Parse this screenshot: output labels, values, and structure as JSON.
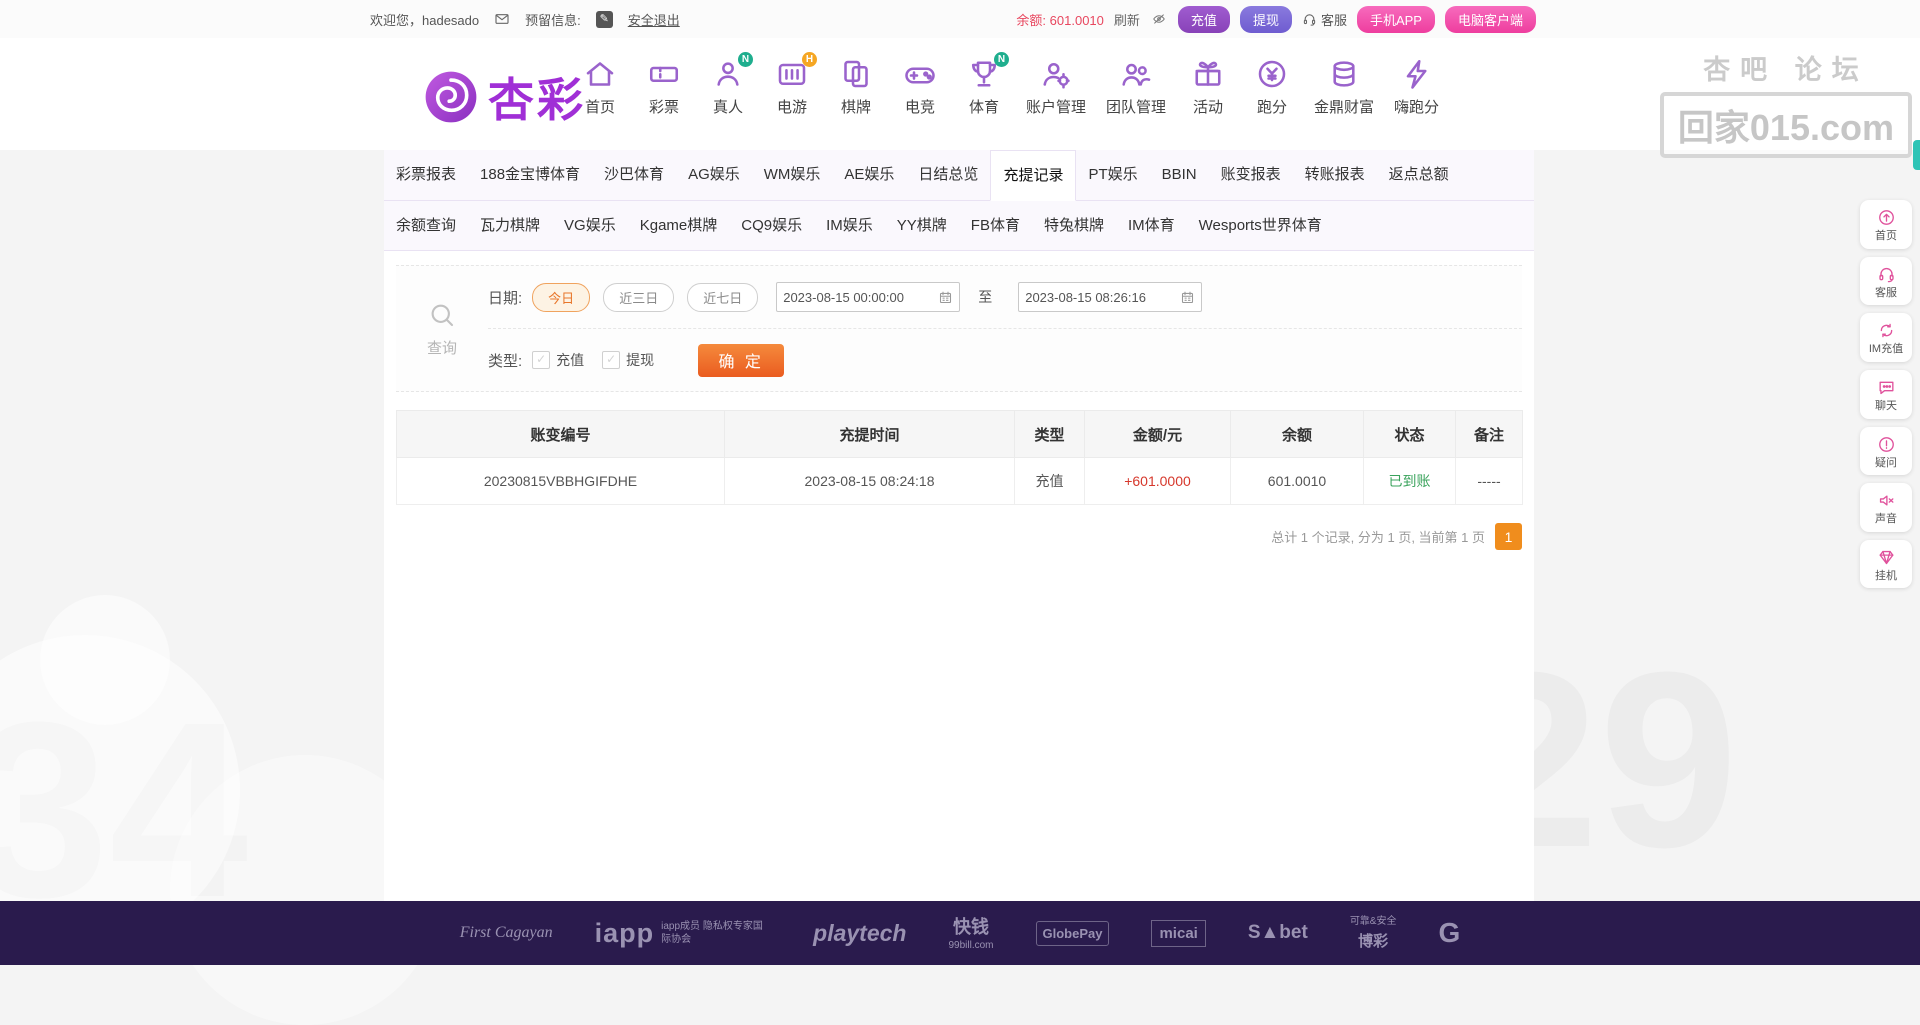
{
  "topbar": {
    "welcome": "欢迎您，hadesado",
    "reserved_label": "预留信息:",
    "logout": "安全退出",
    "balance_label": "余额:",
    "balance_value": "601.0010",
    "refresh": "刷新",
    "deposit": "充值",
    "withdraw": "提现",
    "service": "客服",
    "mobile_app": "手机APP",
    "pc_client": "电脑客户端"
  },
  "header": {
    "brand": "杏彩",
    "nav": [
      {
        "label": "首页",
        "icon": "home-icon",
        "badge": ""
      },
      {
        "label": "彩票",
        "icon": "ticket-icon",
        "badge": ""
      },
      {
        "label": "真人",
        "icon": "person-icon",
        "badge": "N"
      },
      {
        "label": "电游",
        "icon": "slot-icon",
        "badge": "H"
      },
      {
        "label": "棋牌",
        "icon": "tiles-icon",
        "badge": ""
      },
      {
        "label": "电竞",
        "icon": "gamepad-icon",
        "badge": ""
      },
      {
        "label": "体育",
        "icon": "trophy-icon",
        "badge": "N"
      },
      {
        "label": "账户管理",
        "icon": "account-icon",
        "badge": ""
      },
      {
        "label": "团队管理",
        "icon": "team-icon",
        "badge": ""
      },
      {
        "label": "活动",
        "icon": "gift-icon",
        "badge": ""
      },
      {
        "label": "跑分",
        "icon": "coin-icon",
        "badge": ""
      },
      {
        "label": "金鼎财富",
        "icon": "wealth-icon",
        "badge": ""
      },
      {
        "label": "嗨跑分",
        "icon": "run-icon",
        "badge": ""
      }
    ],
    "watermark_line1": "杏吧  论坛",
    "watermark_line2": "回家015.com"
  },
  "tabs": {
    "row1": [
      "彩票报表",
      "188金宝博体育",
      "沙巴体育",
      "AG娱乐",
      "WM娱乐",
      "AE娱乐",
      "日结总览",
      "充提记录",
      "PT娱乐",
      "BBIN",
      "账变报表",
      "转账报表",
      "返点总额"
    ],
    "active": "充提记录",
    "row2": [
      "余额查询",
      "瓦力棋牌",
      "VG娱乐",
      "Kgame棋牌",
      "CQ9娱乐",
      "IM娱乐",
      "YY棋牌",
      "FB体育",
      "特兔棋牌",
      "IM体育",
      "Wesports世界体育"
    ]
  },
  "query": {
    "panel_label": "查询",
    "date_label": "日期:",
    "quick": [
      "今日",
      "近三日",
      "近七日"
    ],
    "quick_active": "今日",
    "date_from": "2023-08-15 00:00:00",
    "to_label": "至",
    "date_to": "2023-08-15 08:26:16",
    "type_label": "类型:",
    "type_options": [
      "充值",
      "提现"
    ],
    "submit": "确 定"
  },
  "table": {
    "headers": [
      "账变编号",
      "充提时间",
      "类型",
      "金额/元",
      "余额",
      "状态",
      "备注"
    ],
    "rows": [
      {
        "id": "20230815VBBHGIFDHE",
        "time": "2023-08-15 08:24:18",
        "type": "充值",
        "amount": "+601.0000",
        "balance": "601.0010",
        "status": "已到账",
        "remark": "-----"
      }
    ],
    "pagination_text": "总计 1 个记录, 分为 1 页, 当前第 1 页",
    "page": "1"
  },
  "sidebar": {
    "items": [
      {
        "label": "首页",
        "icon": "top-icon"
      },
      {
        "label": "客服",
        "icon": "headset-icon"
      },
      {
        "label": "IM充值",
        "icon": "recharge-icon"
      },
      {
        "label": "聊天",
        "icon": "chat-icon"
      },
      {
        "label": "疑问",
        "icon": "question-icon"
      },
      {
        "label": "声音",
        "icon": "sound-icon"
      },
      {
        "label": "挂机",
        "icon": "gem-icon"
      }
    ]
  },
  "footer": {
    "logos": [
      {
        "text": "First Cagayan",
        "sub": ""
      },
      {
        "text": "iapp",
        "sub": "iapp成员 隐私权专家国际协会"
      },
      {
        "text": "playtech",
        "sub": ""
      },
      {
        "text": "快钱",
        "sub": "99bill.com"
      },
      {
        "text": "GlobePay",
        "sub": ""
      },
      {
        "text": "micai",
        "sub": ""
      },
      {
        "text": "S▲bet",
        "sub": ""
      },
      {
        "text": "博彩",
        "sub": "可靠&安全"
      },
      {
        "text": "G",
        "sub": ""
      }
    ]
  },
  "background": {
    "deco_numbers": [
      "34",
      "29"
    ]
  },
  "colors": {
    "accent_purple": "#9a63cc",
    "brand_purple": "#a02fd6",
    "pink": "#ee3d9e",
    "orange_button": "#ea5c20",
    "amount_red": "#d6382c",
    "status_green": "#3aa35c",
    "page_box_orange": "#f08d1d",
    "footer_bg": "#2a1b4d"
  }
}
